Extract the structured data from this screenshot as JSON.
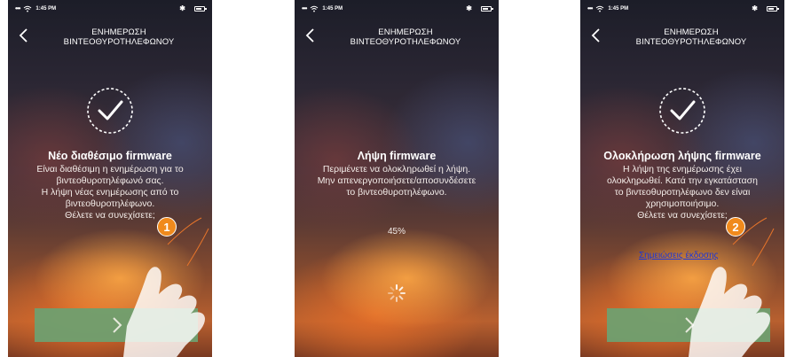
{
  "statusbar": {
    "time": "1:45 PM"
  },
  "header": {
    "title_line1": "ΕΝΗΜΕΡΩΣΗ",
    "title_line2": "ΒΙΝΤΕΟΘΥΡΟΤΗΛΕΦΩΝΟΥ"
  },
  "screen1": {
    "heading": "Νέο διαθέσιμο firmware",
    "body": [
      "Είναι διαθέσιμη η ενημέρωση για το",
      "βιντεοθυροτηλέφωνό σας.",
      "Η λήψη νέας ενημέρωσης από το",
      "βιντεοθυροτηλέφωνο.",
      "Θέλετε να συνεχίσετε;"
    ],
    "marker": "1"
  },
  "screen2": {
    "heading": "Λήψη firmware",
    "body": [
      "Περιμένετε να ολοκληρωθεί η λήψη.",
      "Μην απενεργοποιήσετε/αποσυνδέσετε",
      "το βιντεοθυροτηλέφωνο."
    ],
    "progress": "45%"
  },
  "screen3": {
    "heading": "Ολοκλήρωση λήψης firmware",
    "body": [
      "Η λήψη της ενημέρωσης έχει",
      "ολοκληρωθεί. Κατά την εγκατάσταση",
      "το βιντεοθυροτηλέφωνο δεν είναι",
      "χρησιμοποιήσιμο.",
      "Θέλετε να συνεχίσετε;"
    ],
    "link": "Σημειώσεις έκδοσης",
    "marker": "2"
  },
  "colors": {
    "button": "#6fa070",
    "marker": "#f08a1c",
    "link": "#1a36d8"
  },
  "icons": [
    "back-chevron-icon",
    "check-circle-icon",
    "loading-spinner-icon",
    "next-chevron-icon",
    "wifi-icon",
    "bluetooth-icon",
    "battery-icon",
    "pointing-hand-icon"
  ]
}
